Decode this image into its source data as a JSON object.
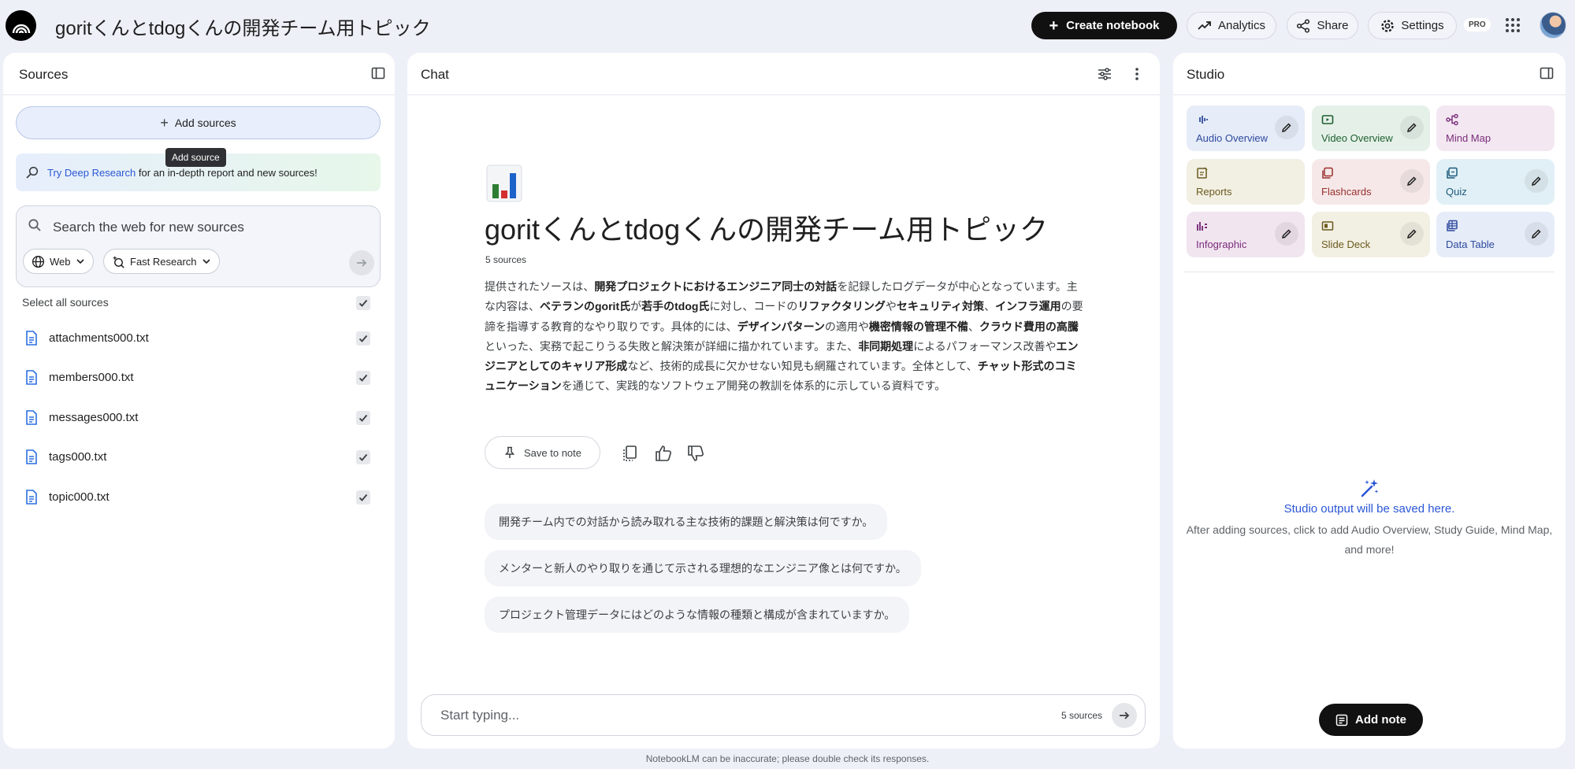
{
  "header": {
    "title": "goritくんとtdogくんの開発チーム用トピック",
    "create_label": "Create notebook",
    "analytics_label": "Analytics",
    "share_label": "Share",
    "settings_label": "Settings",
    "pro_badge": "PRO"
  },
  "sources": {
    "title": "Sources",
    "add_label": "Add sources",
    "tooltip": "Add source",
    "deep_link": "Try Deep Research",
    "deep_rest": "for an in-depth report and new sources!",
    "search_placeholder": "Search the web for new sources",
    "chip_web": "Web",
    "chip_research": "Fast Research",
    "select_all": "Select all sources",
    "items": [
      {
        "name": "attachments000.txt"
      },
      {
        "name": "members000.txt"
      },
      {
        "name": "messages000.txt"
      },
      {
        "name": "tags000.txt"
      },
      {
        "name": "topic000.txt"
      }
    ]
  },
  "chat": {
    "title": "Chat",
    "notebook_title": "goritくんとtdogくんの開発チーム用トピック",
    "source_count": "5 sources",
    "summary": {
      "s1": "提供されたソースは、",
      "b1": "開発プロジェクトにおけるエンジニア同士の対話",
      "s2": "を記録したログデータが中心となっています。主な内容は、",
      "b2": "ベテランのgorit氏",
      "s3": "が",
      "b3": "若手のtdog氏",
      "s4": "に対し、コードの",
      "b4": "リファクタリング",
      "s5": "や",
      "b5": "セキュリティ対策",
      "s6": "、",
      "b6": "インフラ運用",
      "s7": "の要諦を指導する教育的なやり取りです。具体的には、",
      "b7": "デザインパターン",
      "s8": "の適用や",
      "b8": "機密情報の管理不備",
      "s9": "、",
      "b9": "クラウド費用の高騰",
      "s10": "といった、実務で起こりうる失敗と解決策が詳細に描かれています。また、",
      "b10": "非同期処理",
      "s11": "によるパフォーマンス改善や",
      "b11": "エンジニアとしてのキャリア形成",
      "s12": "など、技術的成長に欠かせない知見も網羅されています。全体として、",
      "b12": "チャット形式のコミュニケーション",
      "s13": "を通じて、実践的なソフトウェア開発の教訓を体系的に示している資料です。"
    },
    "save_note_label": "Save to note",
    "suggestions": [
      "開発チーム内での対話から読み取れる主な技術的課題と解決策は何ですか。",
      "メンターと新人のやり取りを通じて示される理想的なエンジニア像とは何ですか。",
      "プロジェクト管理データにはどのような情報の種類と構成が含まれていますか。"
    ],
    "composer_placeholder": "Start typing...",
    "composer_count": "5 sources",
    "disclaimer": "NotebookLM can be inaccurate; please double check its responses."
  },
  "studio": {
    "title": "Studio",
    "tiles": [
      {
        "label": "Audio Overview",
        "color": "#2e4a9e",
        "bg": "#e6ecf8"
      },
      {
        "label": "Video Overview",
        "color": "#1e5f31",
        "bg": "#e5f1e8"
      },
      {
        "label": "Mind Map",
        "color": "#7a2d7a",
        "bg": "#f3e7f1"
      },
      {
        "label": "Reports",
        "color": "#6b5a1e",
        "bg": "#f2efe3"
      },
      {
        "label": "Flashcards",
        "color": "#9a2f2f",
        "bg": "#f6e8e8"
      },
      {
        "label": "Quiz",
        "color": "#1e5a7a",
        "bg": "#e1f0f6"
      },
      {
        "label": "Infographic",
        "color": "#7a2d7a",
        "bg": "#f1e5f0"
      },
      {
        "label": "Slide Deck",
        "color": "#6b5a1e",
        "bg": "#f2efe3"
      },
      {
        "label": "Data Table",
        "color": "#2e4a9e",
        "bg": "#e6ecf8"
      }
    ],
    "empty_title": "Studio output will be saved here.",
    "empty_desc": "After adding sources, click to add Audio Overview, Study Guide, Mind Map, and more!",
    "add_note_label": "Add note"
  }
}
